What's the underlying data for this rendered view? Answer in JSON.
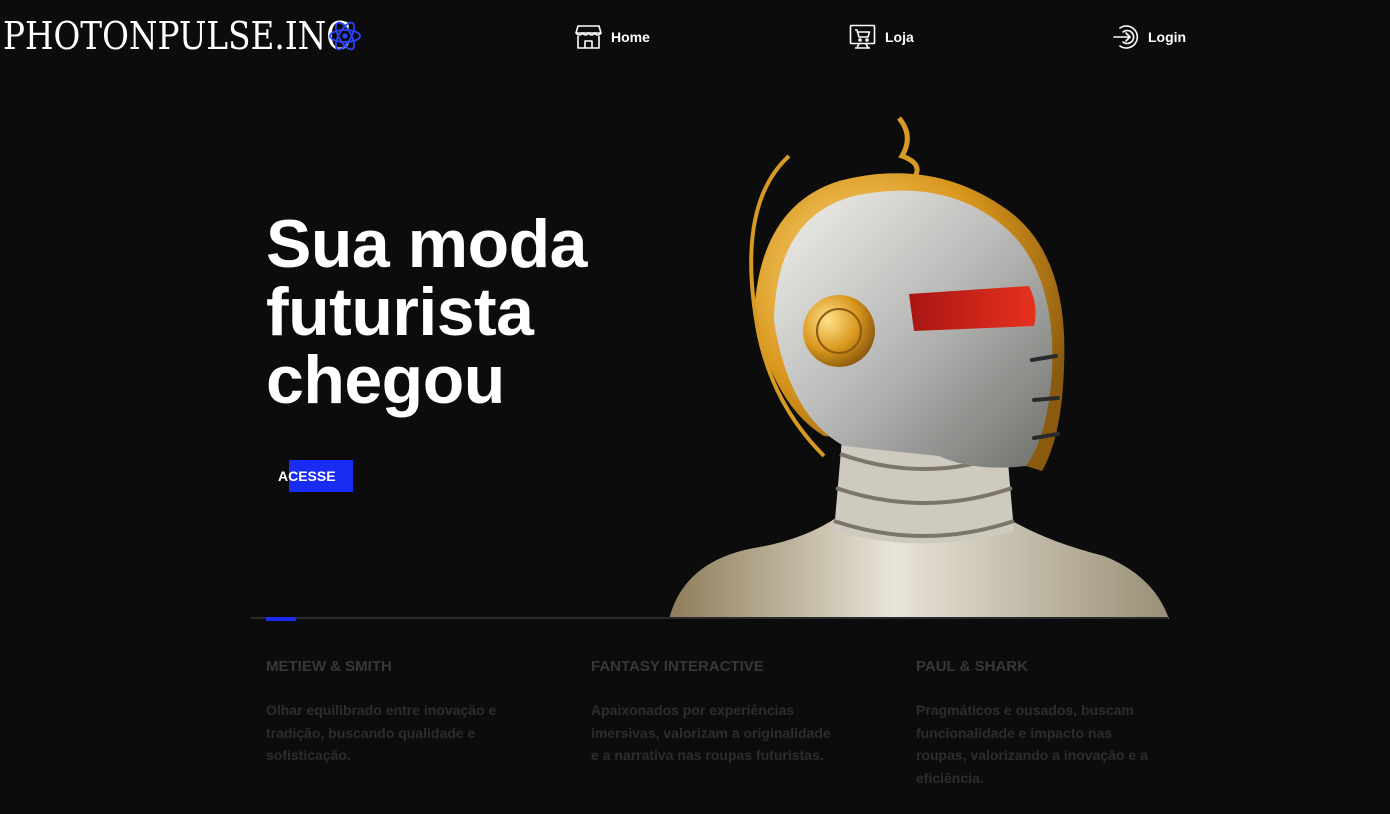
{
  "header": {
    "logo_text": "PHOTONPULSE.INC",
    "nav": {
      "home": "Home",
      "loja": "Loja",
      "login": "Login"
    }
  },
  "hero": {
    "title_lines": [
      "Sua moda",
      "futurista",
      "chegou"
    ],
    "cta_label": "ACESSE"
  },
  "slider": {
    "progress_fraction": 0.033
  },
  "brands": [
    {
      "name": "METIEW & SMITH",
      "description": "Olhar equilibrado entre inovação e tradição, buscando qualidade e sofisticação."
    },
    {
      "name": "FANTASY INTERACTIVE",
      "description": "Apaixonados por experiências imersivas, valorizam a originalidade e a narrativa nas roupas futuristas."
    },
    {
      "name": "PAUL & SHARK",
      "description": "Pragmáticos e ousados, buscam funcionalidade e impacto nas roupas, valorizando a inovação e a eficiência."
    }
  ],
  "colors": {
    "background": "#0c0c0d",
    "accent": "#1a2cf2",
    "text": "#ffffff",
    "muted": "#37373a"
  }
}
